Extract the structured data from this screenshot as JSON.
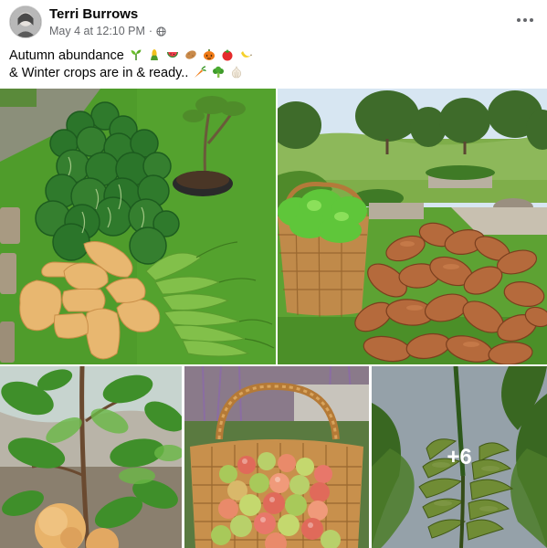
{
  "post": {
    "author": "Terri Burrows",
    "timestamp": "May 4 at 12:10 PM",
    "separator": "·",
    "privacy_icon": "globe-icon",
    "more_icon": "more-options-icon",
    "text_line1": "Autumn abundance",
    "text_line2": "& Winter crops are in & ready..",
    "line1_emojis": [
      "sprout-emoji",
      "corn-emoji",
      "watermelon-emoji",
      "potato-emoji",
      "pumpkin-emoji",
      "tomato-emoji",
      "banana-emoji"
    ],
    "line2_emojis": [
      "carrot-emoji",
      "broccoli-emoji",
      "garlic-emoji"
    ]
  },
  "photos": {
    "more_count": "+6"
  },
  "colors": {
    "name": "#050505",
    "meta": "#65676b",
    "grass": "#4e9a2a",
    "sky": "#d7e6f2"
  }
}
